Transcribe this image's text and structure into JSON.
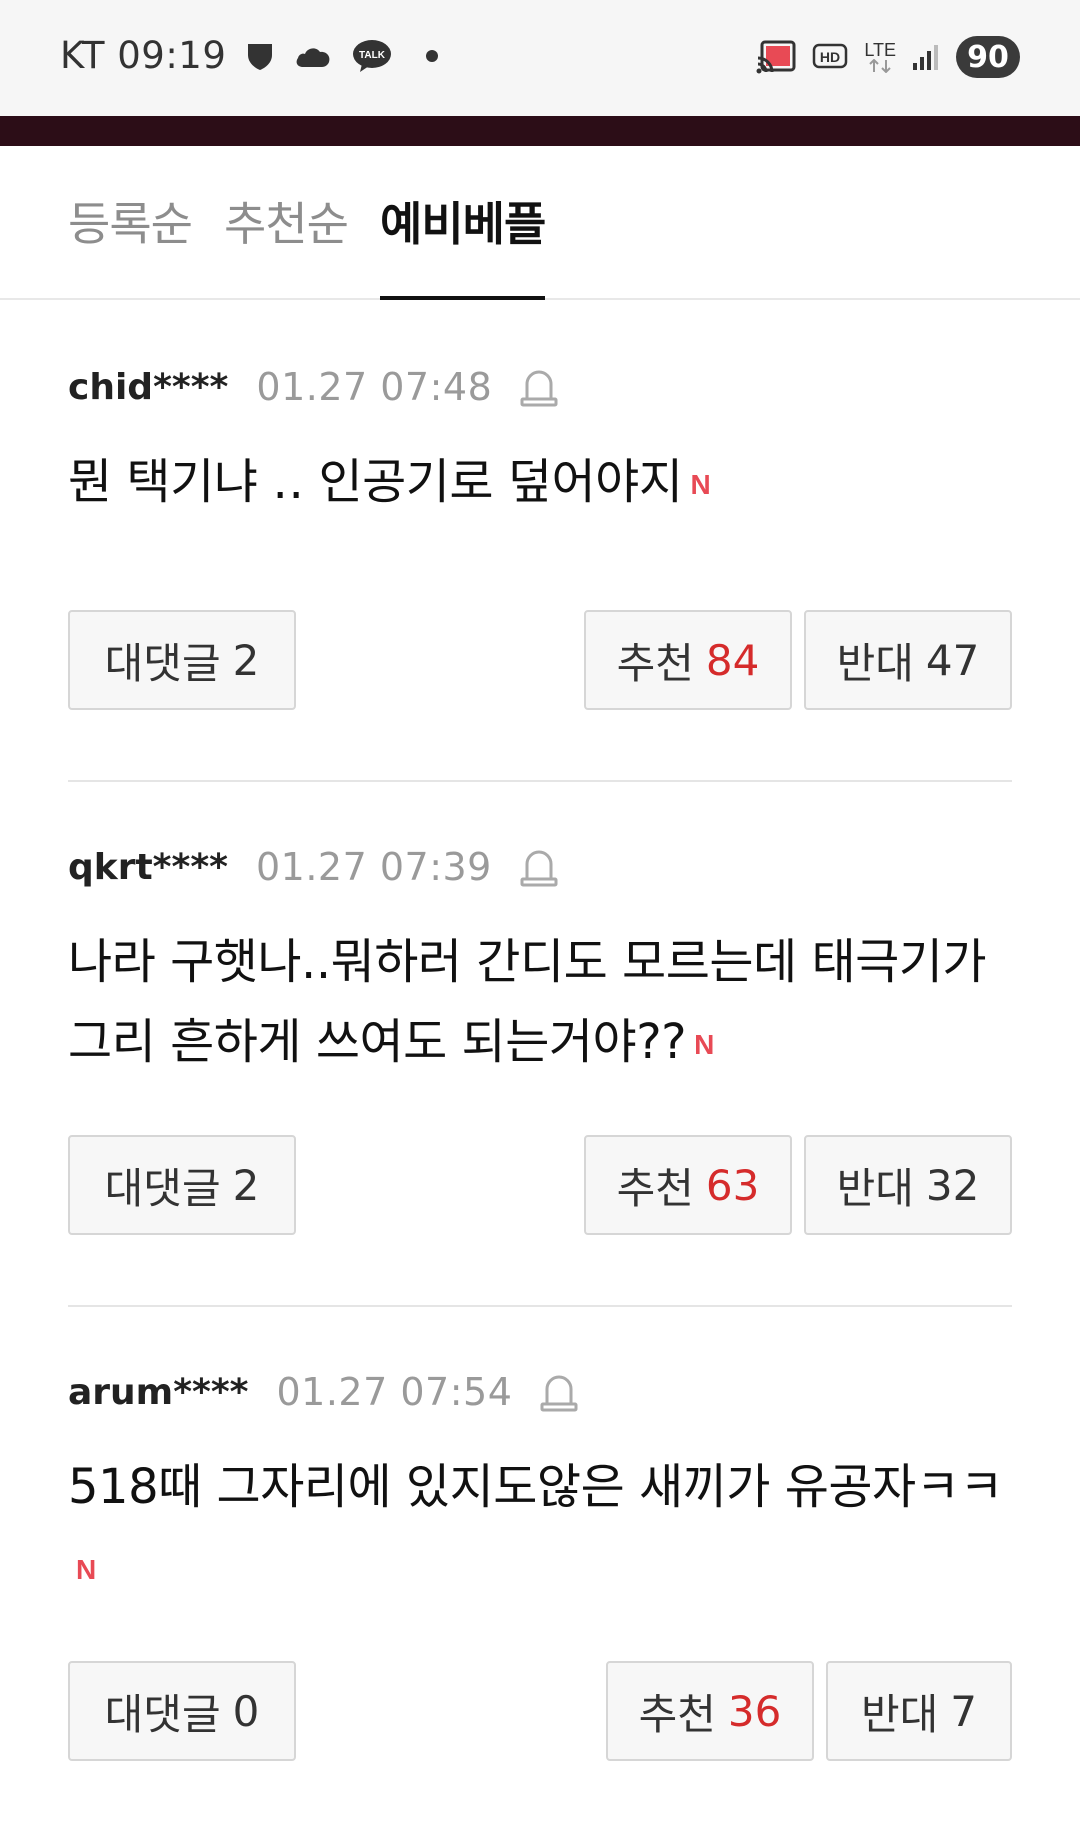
{
  "status_bar": {
    "carrier_time": "KT 09:19",
    "network": "LTE",
    "battery": "90"
  },
  "tabs": [
    {
      "label": "등록순",
      "active": false
    },
    {
      "label": "추천순",
      "active": false
    },
    {
      "label": "예비베플",
      "active": true
    }
  ],
  "comments": [
    {
      "user": "chid****",
      "time": "01.27 07:48",
      "text": "뭔 택기냐 ‥ 인공기로 덮어야지",
      "new_badge": "N",
      "reply_label": "대댓글",
      "reply_count": "2",
      "like_label": "추천",
      "like_count": "84",
      "dislike_label": "반대",
      "dislike_count": "47"
    },
    {
      "user": "qkrt****",
      "time": "01.27 07:39",
      "text": "나라 구햇나..뭐하러 간디도 모르는데 태극기가 그리 흔하게 쓰여도 되는거야??",
      "new_badge": "N",
      "reply_label": "대댓글",
      "reply_count": "2",
      "like_label": "추천",
      "like_count": "63",
      "dislike_label": "반대",
      "dislike_count": "32"
    },
    {
      "user": "arum****",
      "time": "01.27 07:54",
      "text": "518때 그자리에 있지도않은 새끼가 유공자ㅋㅋ",
      "new_badge": "N",
      "reply_label": "대댓글",
      "reply_count": "0",
      "like_label": "추천",
      "like_count": "36",
      "dislike_label": "반대",
      "dislike_count": "7"
    }
  ],
  "colors": {
    "header_band": "#2c0d17",
    "like_count": "#d52b2b",
    "new_badge": "#e84a55"
  }
}
